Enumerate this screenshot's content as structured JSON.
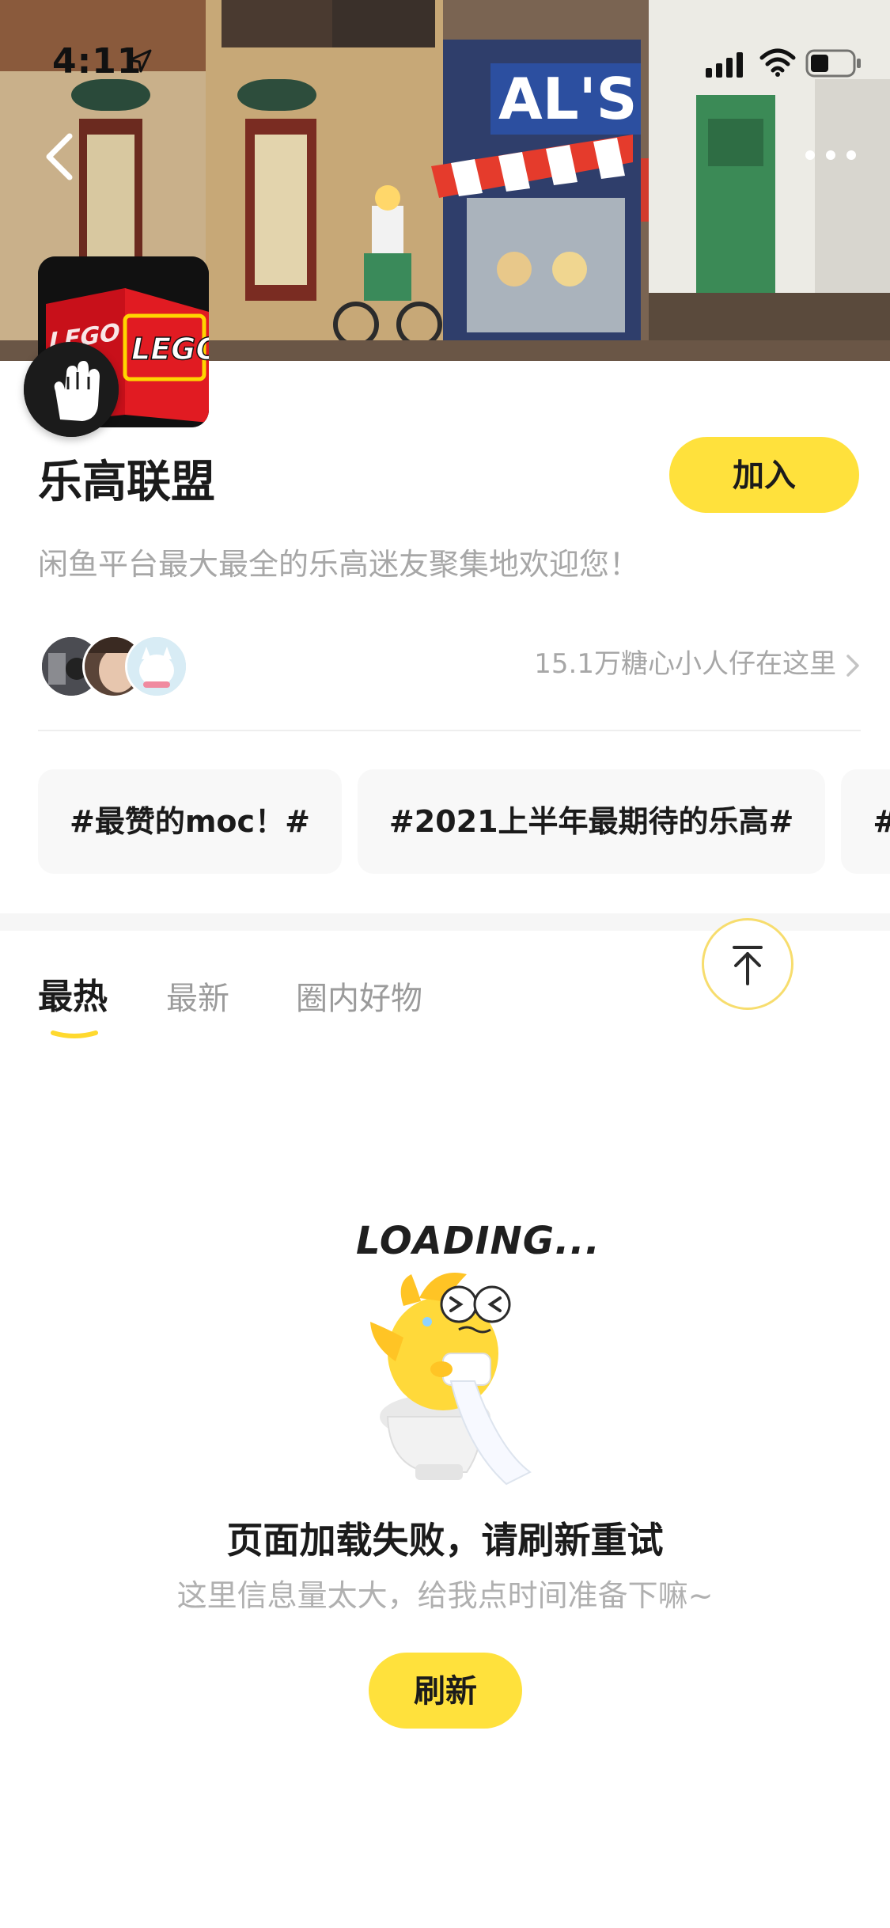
{
  "status_bar": {
    "time": "4:11",
    "icons": [
      "location-arrow-icon",
      "cellular-signal-icon",
      "wifi-icon",
      "battery-icon"
    ]
  },
  "header": {
    "back_icon": "chevron-left-icon",
    "more_icon": "more-dots-icon",
    "banner_image": "lego-street-scene-photo"
  },
  "group": {
    "avatar_logo_text": "LEGO",
    "avatar_logo_text_partial": "LEGO",
    "badge_icon": "raised-hand-icon",
    "title": "乐高联盟",
    "join_label": "加入",
    "description": "闲鱼平台最大最全的乐高迷友聚集地欢迎您！",
    "member_count_text": "15.1万糖心小人仔在这里"
  },
  "topics": [
    {
      "label": "#最赞的moc！#"
    },
    {
      "label": "#2021上半年最期待的乐高#"
    },
    {
      "label": "#"
    }
  ],
  "tabs": [
    {
      "label": "最热",
      "active": true
    },
    {
      "label": "最新",
      "active": false
    },
    {
      "label": "圈内好物",
      "active": false
    }
  ],
  "scroll_top_icon": "arrow-up-to-top-icon",
  "error_state": {
    "loading_text": "LOADING...",
    "illustration": "fish-on-toilet-icon",
    "title": "页面加载失败，请刷新重试",
    "subtitle": "这里信息量太大，给我点时间准备下嘛~",
    "refresh_label": "刷新"
  },
  "colors": {
    "accent_yellow": "#ffe13c",
    "title_text": "#1b1b1b",
    "secondary_text": "#a7a7a7",
    "chip_background": "#f8f8f8"
  }
}
